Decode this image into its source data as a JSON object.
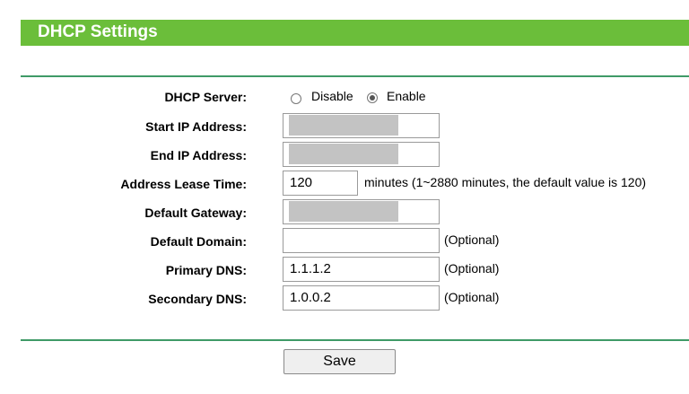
{
  "header": {
    "title": "DHCP Settings"
  },
  "form": {
    "dhcp_server": {
      "label": "DHCP Server:",
      "options": [
        {
          "label": "Disable",
          "checked": false
        },
        {
          "label": "Enable",
          "checked": true
        }
      ]
    },
    "start_ip": {
      "label": "Start IP Address:",
      "value": ""
    },
    "end_ip": {
      "label": "End IP Address:",
      "value": ""
    },
    "lease_time": {
      "label": "Address Lease Time:",
      "value": "120",
      "hint": "minutes (1~2880 minutes, the default value is 120)"
    },
    "default_gateway": {
      "label": "Default Gateway:",
      "value": ""
    },
    "default_domain": {
      "label": "Default Domain:",
      "value": "",
      "hint": "(Optional)"
    },
    "primary_dns": {
      "label": "Primary DNS:",
      "value": "1.1.1.2",
      "hint": "(Optional)"
    },
    "secondary_dns": {
      "label": "Secondary DNS:",
      "value": "1.0.0.2",
      "hint": "(Optional)"
    }
  },
  "actions": {
    "save_label": "Save"
  },
  "colors": {
    "header_bg": "#6bbe3a",
    "rule": "#3f9a67"
  }
}
